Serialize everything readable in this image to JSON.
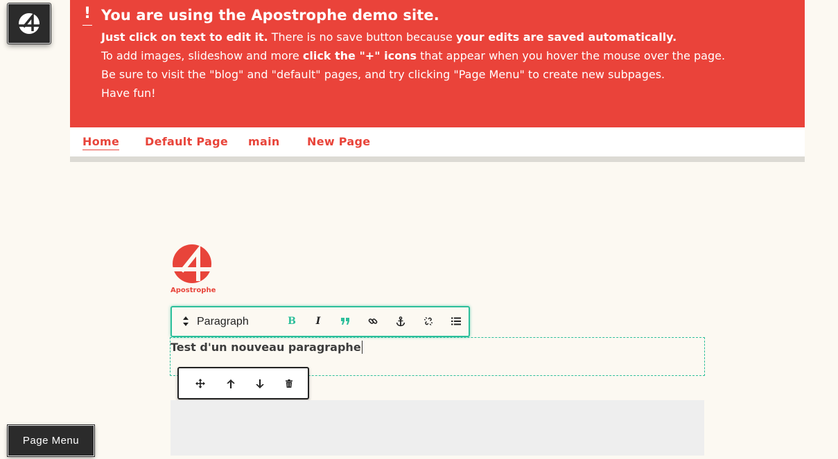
{
  "admin": {
    "icon": "apostrophe-logo-icon"
  },
  "banner": {
    "mark": "!",
    "title": "You are using the Apostrophe demo site.",
    "line1": {
      "b1": "Just click on text to edit it.",
      "t1": " There is no save button because ",
      "b2": "your edits are saved automatically."
    },
    "line2": {
      "t1": "To add images, slideshow and more ",
      "b1": "click the \"+\" icons",
      "t2": " that appear when you hover the mouse over the page."
    },
    "line3": "Be sure to visit the \"blog\" and \"default\" pages, and try clicking \"Page Menu\" to create new subpages.",
    "line4": "Have fun!"
  },
  "nav": {
    "items": [
      {
        "label": "Home",
        "active": true
      },
      {
        "label": "Default Page",
        "active": false
      },
      {
        "label": "main",
        "active": false
      },
      {
        "label": "New Page",
        "active": false
      }
    ]
  },
  "logo": {
    "text": "Apostrophe"
  },
  "editor_toolbar": {
    "style_label": "Paragraph",
    "buttons": [
      "bold-icon",
      "italic-icon",
      "blockquote-icon",
      "link-icon",
      "anchor-icon",
      "unlink-icon",
      "bullet-list-icon"
    ]
  },
  "content": {
    "paragraph": "Test d'un nouveau paragraphe"
  },
  "widget_controls": {
    "buttons": [
      "move-icon",
      "arrow-up-icon",
      "arrow-down-icon",
      "trash-icon"
    ]
  },
  "page_menu": {
    "label": "Page Menu"
  },
  "colors": {
    "accent": "#ea433a",
    "editor": "#2dbf9b",
    "dark": "#2b2b2b",
    "background": "#fcf9f2"
  }
}
